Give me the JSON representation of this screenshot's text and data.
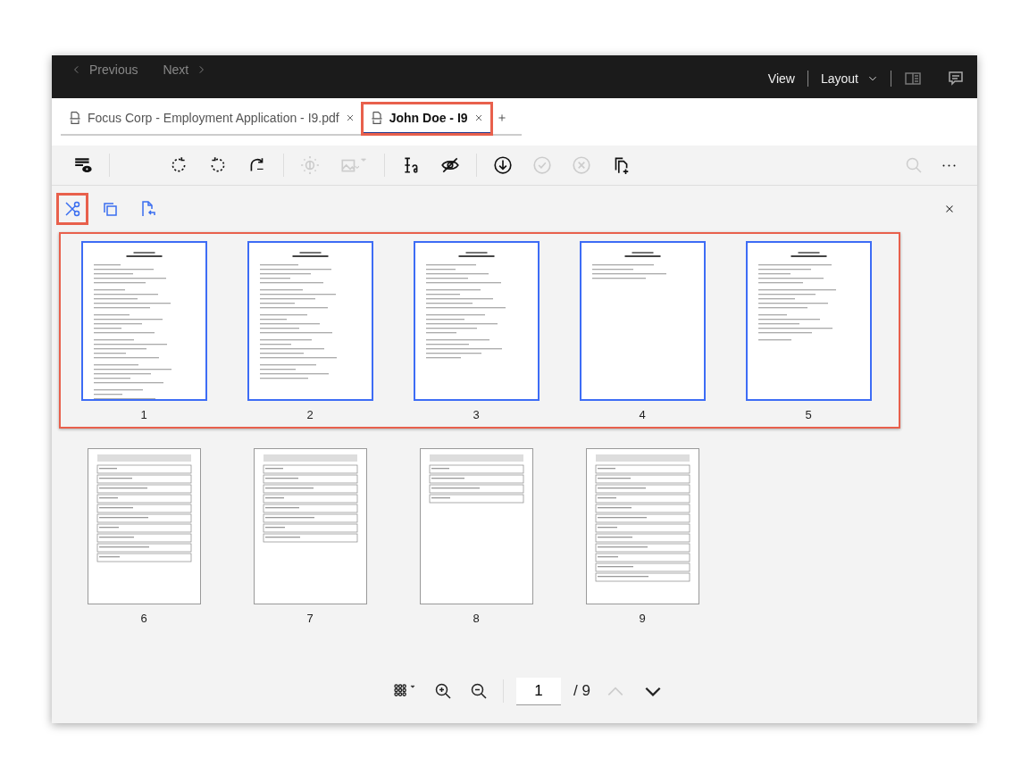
{
  "header": {
    "nav": [
      {
        "label": "Previous",
        "disabled": true
      },
      {
        "label": "Next",
        "disabled": true
      }
    ],
    "menus": [
      {
        "label": "View"
      },
      {
        "label": "Layout"
      }
    ],
    "panel_on": false
  },
  "tabs": [
    {
      "label": "Focus Corp - Employment Application - I9.pdf",
      "selected": false,
      "highlighted": false
    },
    {
      "label": "John Doe - I9",
      "selected": true,
      "highlighted": true
    }
  ],
  "toolbar": {
    "groups": [
      [
        {
          "disabled": false
        }
      ],
      [
        {
          "disabled": false
        },
        {
          "disabled": false
        },
        {
          "disabled": false
        }
      ],
      [
        {
          "disabled": true
        },
        {
          "disabled": true
        }
      ],
      [
        {
          "disabled": false
        },
        {
          "disabled": false
        }
      ],
      [
        {
          "disabled": false
        },
        {
          "disabled": true
        },
        {
          "disabled": true
        },
        {
          "disabled": false
        }
      ]
    ],
    "right": [
      {
        "disabled": true
      },
      {
        "disabled": false
      }
    ]
  },
  "page_tools": [
    {
      "highlighted": true
    },
    {
      "highlighted": false
    },
    {
      "highlighted": false
    }
  ],
  "page_rows": [
    {
      "highlighted": true,
      "pages": [
        {
          "number": "1",
          "kind": "text",
          "selected": true
        },
        {
          "number": "2",
          "kind": "text",
          "selected": true
        },
        {
          "number": "3",
          "kind": "text",
          "selected": true
        },
        {
          "number": "4",
          "kind": "text",
          "selected": true
        },
        {
          "number": "5",
          "kind": "text",
          "selected": true
        }
      ]
    },
    {
      "highlighted": false,
      "pages": [
        {
          "number": "6",
          "kind": "form",
          "selected": false
        },
        {
          "number": "7",
          "kind": "form",
          "selected": false
        },
        {
          "number": "8",
          "kind": "form",
          "selected": false
        },
        {
          "number": "9",
          "kind": "form",
          "selected": false
        }
      ]
    }
  ],
  "footer": {
    "page_value": "1",
    "page_total": "/ 9",
    "prev_disabled": true,
    "next_disabled": false
  }
}
